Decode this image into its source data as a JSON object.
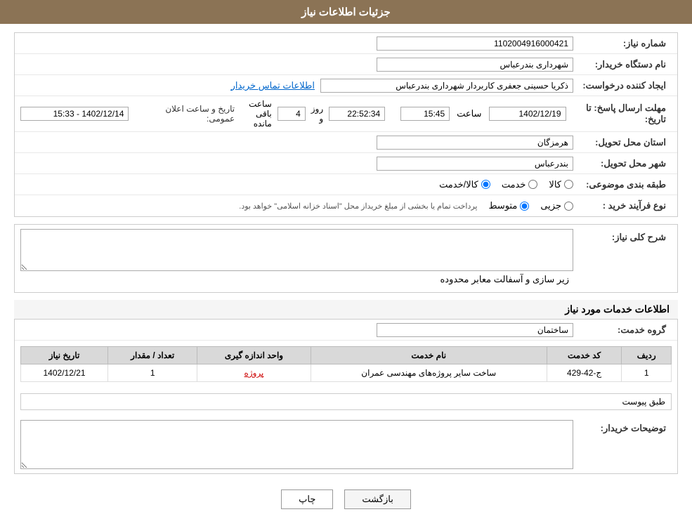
{
  "header": {
    "title": "جزئیات اطلاعات نیاز"
  },
  "fields": {
    "shomareNiaz_label": "شماره نیاز:",
    "shomareNiaz_value": "1102004916000421",
    "namDastgah_label": "نام دستگاه خریدار:",
    "namDastgah_value": "شهرداری بندرعباس",
    "eijadKonande_label": "ایجاد کننده درخواست:",
    "eijadKonande_value": "ذکریا حسینی جعفری کاربردار شهرداری بندرعباس",
    "eijadKonande_link": "اطلاعات تماس خریدار",
    "mohlat_label": "مهلت ارسال پاسخ: تا تاریخ:",
    "mohlat_date": "1402/12/19",
    "mohlat_time_label": "ساعت",
    "mohlat_time": "15:45",
    "mohlat_remaining_label": "روز و",
    "mohlat_days": "4",
    "mohlat_clock": "22:52:34",
    "mohlat_remaining_suffix": "ساعت باقی مانده",
    "announceTime_label": "تاریخ و ساعت اعلان عمومی:",
    "announceTime_value": "1402/12/14 - 15:33",
    "ostan_label": "استان محل تحویل:",
    "ostan_value": "هرمزگان",
    "shahr_label": "شهر محل تحویل:",
    "shahr_value": "بندرعباس",
    "tabaqeBandi_label": "طبقه بندی موضوعی:",
    "tabaqe_kala": "کالا",
    "tabaqe_khadamat": "خدمت",
    "tabaqe_kala_khadamat": "کالا/خدمت",
    "noeFarayand_label": "نوع فرآیند خرید :",
    "noeFarayand_jazee": "جزیی",
    "noeFarayand_motevaset": "متوسط",
    "noeFarayand_note": "پرداخت تمام یا بخشی از مبلغ خریداز محل \"اسناد خزانه اسلامی\" خواهد بود.",
    "sharh_label": "شرح کلی نیاز:",
    "sharh_value": "زیر سازی و آسفالت معابر محدوده",
    "services_section_title": "اطلاعات خدمات مورد نیاز",
    "geroheKhadamat_label": "گروه خدمت:",
    "geroheKhadamat_value": "ساختمان",
    "table_headers": {
      "radif": "ردیف",
      "kodKhadamat": "کد خدمت",
      "namKhadamat": "نام خدمت",
      "vahedAndaze": "واحد اندازه گیری",
      "tedad_megdar": "تعداد / مقدار",
      "tarikh_niaz": "تاریخ نیاز"
    },
    "table_rows": [
      {
        "radif": "1",
        "kod": "ج-42-429",
        "nam": "ساخت سایر پروژه‌های مهندسی عمران",
        "vahed": "پروژه",
        "tedad": "1",
        "tarikh": "1402/12/21"
      }
    ],
    "tabq_peivast": "طبق پیوست",
    "buyer_notes_label": "توضیحات خریدار:"
  },
  "buttons": {
    "print_label": "چاپ",
    "back_label": "بازگشت"
  }
}
